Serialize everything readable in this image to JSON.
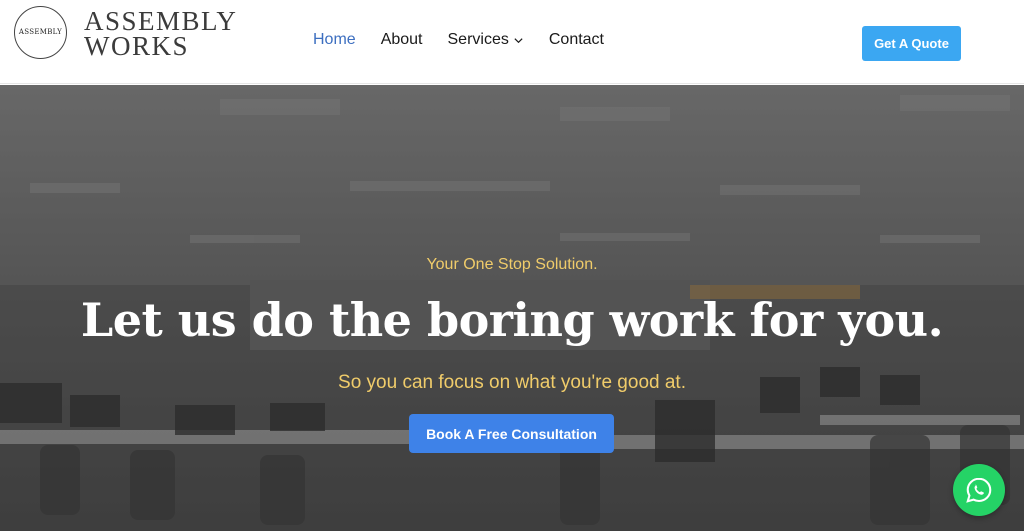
{
  "logo": {
    "badge_text": "ASSEMBLY",
    "line1": "ASSEMBLY",
    "line2": "WORKS"
  },
  "nav": {
    "items": [
      {
        "label": "Home",
        "active": true
      },
      {
        "label": "About",
        "active": false
      },
      {
        "label": "Services",
        "active": false,
        "has_dropdown": true
      },
      {
        "label": "Contact",
        "active": false
      }
    ]
  },
  "header": {
    "quote_button": "Get A Quote"
  },
  "hero": {
    "eyebrow": "Your One Stop Solution.",
    "title": "Let us do the boring work for you.",
    "subtitle": "So you can focus on what you're good at.",
    "cta": "Book A Free Consultation",
    "background": "office-interior-photo"
  },
  "floating": {
    "whatsapp_icon": "whatsapp-icon"
  },
  "colors": {
    "nav_active": "#3d6fc0",
    "quote_button": "#3ba7f2",
    "cta_button": "#3e82e8",
    "accent_gold": "#f0cc6a",
    "whatsapp": "#25d366"
  }
}
